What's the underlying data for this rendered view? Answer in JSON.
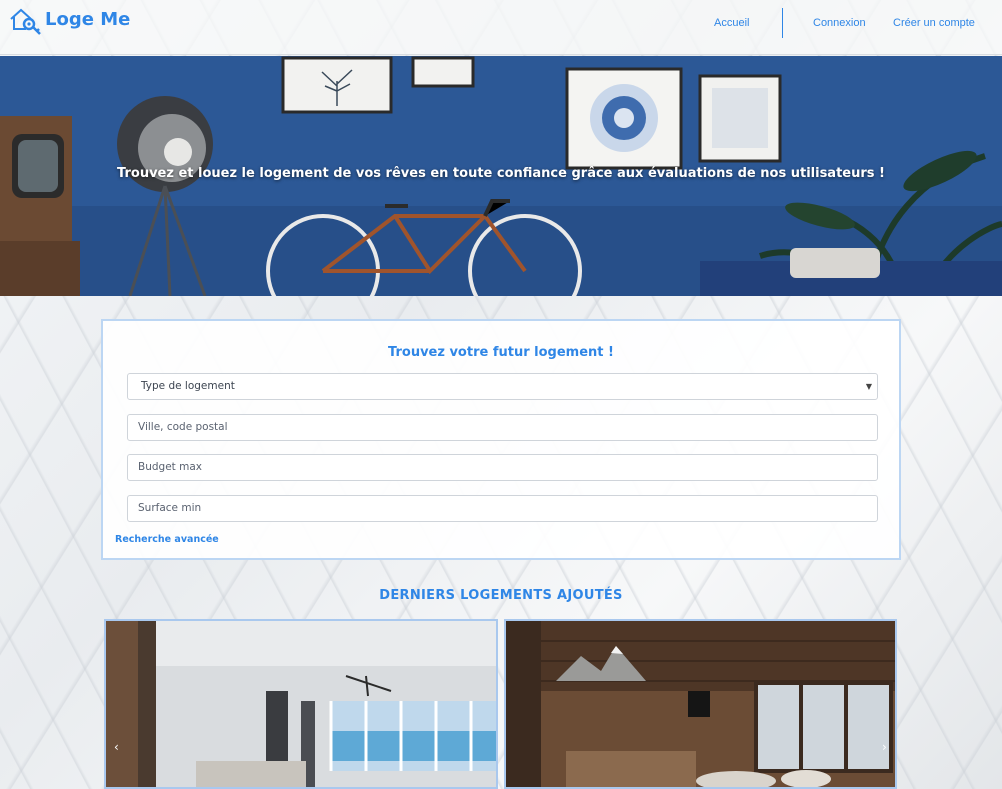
{
  "brand": {
    "name": "Loge Me"
  },
  "nav": {
    "home": "Accueil",
    "login": "Connexion",
    "register": "Créer un compte"
  },
  "hero": {
    "title": "Trouvez et louez le logement de vos rêves en toute confiance grâce aux évaluations de nos utilisateurs !"
  },
  "search": {
    "title": "Trouvez votre futur logement !",
    "type_select": {
      "selected": "Type de logement"
    },
    "city_placeholder": "Ville, code postal",
    "budget_placeholder": "Budget max",
    "surface_placeholder": "Surface min",
    "advanced_link": "Recherche avancée"
  },
  "listings": {
    "title": "DERNIERS LOGEMENTS AJOUTÉS"
  },
  "colors": {
    "accent": "#2f86e6",
    "hero_wall": "#2a5596"
  },
  "icons": [
    "house-key-logo-icon",
    "chevron-down-icon",
    "carousel-prev-icon",
    "carousel-next-icon"
  ]
}
